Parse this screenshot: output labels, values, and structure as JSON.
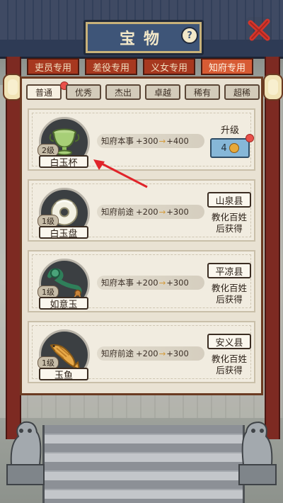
{
  "title": "宝物",
  "category_tabs": [
    {
      "label": "吏员专用",
      "active": false
    },
    {
      "label": "差役专用",
      "active": false
    },
    {
      "label": "义女专用",
      "active": false
    },
    {
      "label": "知府专用",
      "active": true
    }
  ],
  "sub_tabs": [
    {
      "label": "普通",
      "active": true
    },
    {
      "label": "优秀",
      "active": false
    },
    {
      "label": "杰出",
      "active": false
    },
    {
      "label": "卓越",
      "active": false
    },
    {
      "label": "稀有",
      "active": false
    },
    {
      "label": "超稀",
      "active": false
    }
  ],
  "items": [
    {
      "name": "白玉杯",
      "level": "2级",
      "effect_stat": "知府本事",
      "effect_current": "+300",
      "effect_next": "+400",
      "action": "upgrade",
      "upgrade_label": "升级",
      "upgrade_cost": "4"
    },
    {
      "name": "白玉盘",
      "level": "1级",
      "effect_stat": "知府前途",
      "effect_current": "+200",
      "effect_next": "+300",
      "action": "source",
      "source_place": "山泉县",
      "source_note": "教化百姓后获得"
    },
    {
      "name": "如意玉",
      "level": "1级",
      "effect_stat": "知府本事",
      "effect_current": "+200",
      "effect_next": "+300",
      "action": "source",
      "source_place": "平凉县",
      "source_note": "教化百姓后获得"
    },
    {
      "name": "玉鱼",
      "level": "1级",
      "effect_stat": "知府前途",
      "effect_current": "+200",
      "effect_next": "+300",
      "action": "source",
      "source_place": "安义县",
      "source_note": "教化百姓后获得"
    }
  ],
  "colors": {
    "accent_tab": "#d75b34",
    "upgrade_button": "#86b7d8",
    "notification_dot": "#e9504a",
    "annotation_arrow": "#e0242a"
  },
  "icons": {
    "help": "?",
    "close": "close-x-icon",
    "coin": "coin-icon"
  }
}
